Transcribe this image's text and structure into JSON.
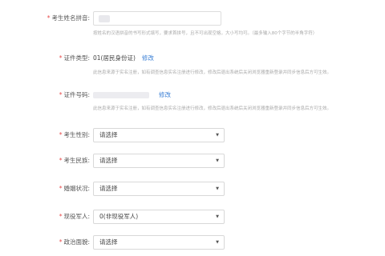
{
  "name_pinyin": {
    "label": "考生姓名拼音:",
    "hint": "按姓名的汉语拼音的书写形式填写，要求首拼号，且不可出现空格，大小写均可。（最多输入80个字节的半角字符）"
  },
  "id_type": {
    "label": "证件类型:",
    "value": "01(居民身份证)",
    "edit_label": "修改",
    "hint": "此信息来源于实名注册，如有调查信息实名注册进行修改，修改后退出系统后关闭浏览器重新登录并同步信息后方可生效。"
  },
  "id_number": {
    "label": "证件号码:",
    "edit_label": "修改",
    "hint": "此信息来源于实名注册，如有调查信息实名注册进行修改，修改后退出系统后关闭浏览器重新登录并同步信息后方可生效。"
  },
  "gender": {
    "label": "考生性别:",
    "selected": "请选择"
  },
  "ethnicity": {
    "label": "考生民族:",
    "selected": "请选择"
  },
  "marital": {
    "label": "婚姻状况:",
    "selected": "请选择"
  },
  "military": {
    "label": "现役军人:",
    "selected": "0(非现役军人)"
  },
  "political": {
    "label": "政治面貌:",
    "selected": "请选择"
  },
  "required_mark": "*",
  "caret_glyph": "▼",
  "colors": {
    "required": "#e84a4a",
    "link": "#3a7fd5",
    "hint": "#a9a9a9"
  }
}
